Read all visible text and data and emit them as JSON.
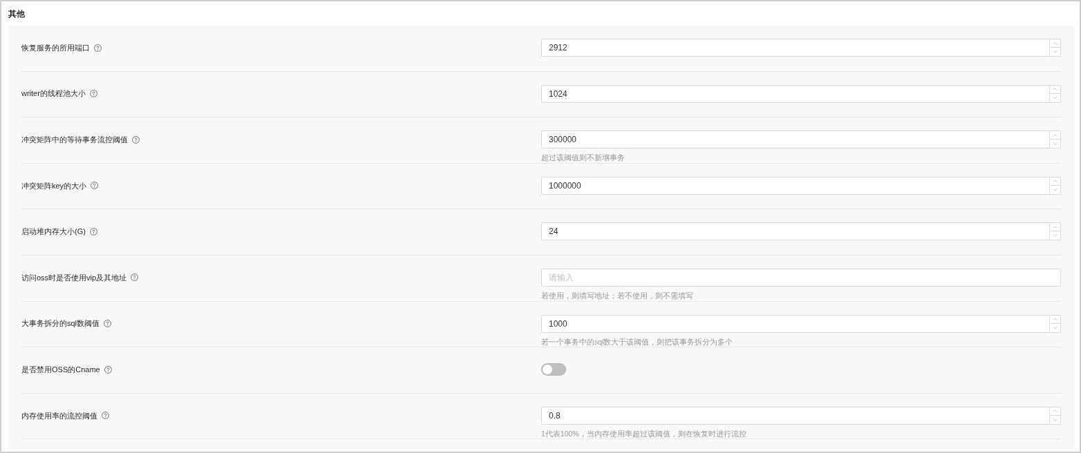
{
  "section": {
    "title": "其他"
  },
  "fields": [
    {
      "kind": "number",
      "label": "恢复服务的所用端口",
      "value": "2912"
    },
    {
      "kind": "number",
      "label": "writer的线程池大小",
      "value": "1024"
    },
    {
      "kind": "number",
      "label": "冲突矩阵中的等待事务流控阈值",
      "value": "300000",
      "help": "超过该阈值则不新增事务"
    },
    {
      "kind": "number",
      "label": "冲突矩阵key的大小",
      "value": "1000000"
    },
    {
      "kind": "number",
      "label": "启动堆内存大小(G)",
      "value": "24"
    },
    {
      "kind": "text",
      "label": "访问oss时是否使用vip及其地址",
      "placeholder": "请输入",
      "help": "若使用，则填写地址；若不使用，则不需填写"
    },
    {
      "kind": "number",
      "label": "大事务拆分的sql数阈值",
      "value": "1000",
      "help": "若一个事务中的sql数大于该阈值，则把该事务拆分为多个"
    },
    {
      "kind": "switch",
      "label": "是否禁用OSS的Cname",
      "on": false
    },
    {
      "kind": "number",
      "label": "内存使用率的流控阈值",
      "value": "0.8",
      "help": "1代表100%，当内存使用率超过该阈值，则在恢复时进行流控"
    }
  ]
}
